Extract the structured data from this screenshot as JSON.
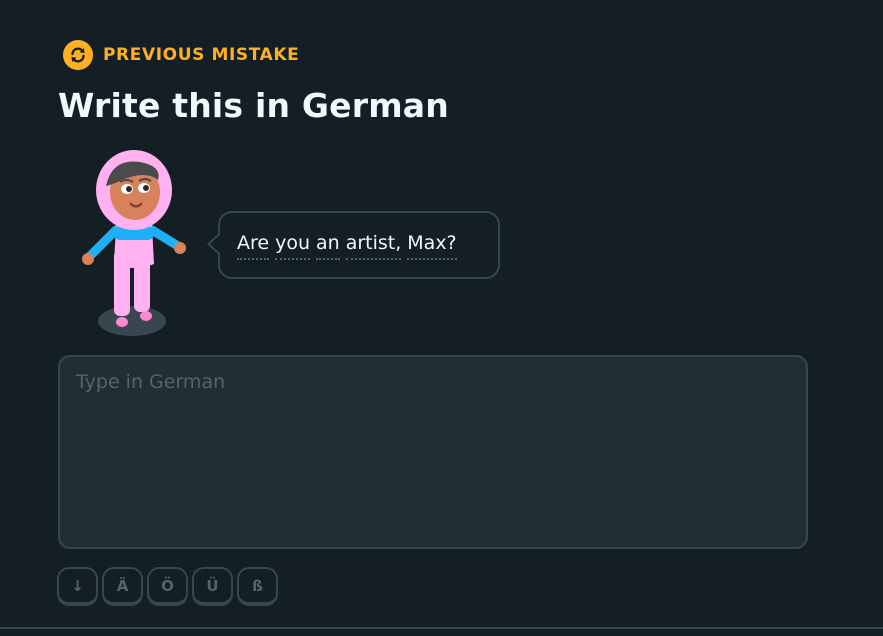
{
  "header": {
    "badge_label": "PREVIOUS MISTAKE",
    "badge_icon": "refresh-icon",
    "badge_color": "#ffb020"
  },
  "challenge": {
    "title": "Write this in German",
    "prompt_words": [
      "Are",
      "you",
      "an",
      "artist,",
      "Max?"
    ]
  },
  "answer": {
    "placeholder": "Type in German",
    "value": ""
  },
  "special_characters": [
    {
      "label": "↓",
      "icon": "arrow-down-icon"
    },
    {
      "label": "Ä"
    },
    {
      "label": "Ö"
    },
    {
      "label": "Ü"
    },
    {
      "label": "ß"
    }
  ],
  "colors": {
    "background": "#131f24",
    "input_background": "#202f36",
    "border": "#37464f",
    "text": "#f1f7fb",
    "muted": "#52656d",
    "accent": "#ffb020"
  }
}
